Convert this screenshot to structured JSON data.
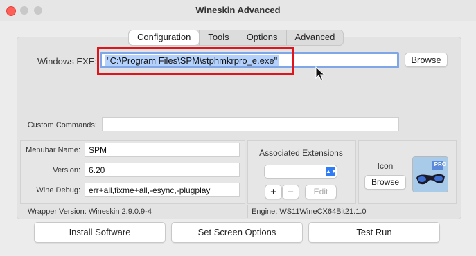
{
  "window": {
    "title": "Wineskin Advanced"
  },
  "tabs": [
    {
      "label": "Configuration",
      "active": true
    },
    {
      "label": "Tools"
    },
    {
      "label": "Options"
    },
    {
      "label": "Advanced"
    }
  ],
  "config": {
    "windows_exe_label": "Windows EXE:",
    "windows_exe_value": "\"C:\\Program Files\\SPM\\stphmkrpro_e.exe\"",
    "browse_label": "Browse",
    "custom_commands_label": "Custom Commands:",
    "custom_commands_value": "",
    "menubar_name_label": "Menubar Name:",
    "menubar_name_value": "SPM",
    "version_label": "Version:",
    "version_value": "6.20",
    "wine_debug_label": "Wine Debug:",
    "wine_debug_value": "err+all,fixme+all,-esync,-plugplay",
    "assoc_ext_label": "Associated Extensions",
    "add_label": "+",
    "remove_label": "−",
    "edit_label": "Edit",
    "icon_label": "Icon",
    "icon_browse_label": "Browse",
    "icon_badge": "PRO"
  },
  "status": {
    "wrapper_version": "Wrapper Version:  Wineskin 2.9.0.9-4",
    "engine": "Engine:  WS11WineCX64Bit21.1.0"
  },
  "buttons": {
    "install_software": "Install Software",
    "set_screen_options": "Set Screen Options",
    "test_run": "Test Run"
  },
  "colors": {
    "highlight_box": "#e0141a",
    "selection": "#b3d1fb",
    "focus_ring": "#7fa7e8",
    "close_button": "#ff5f57"
  }
}
